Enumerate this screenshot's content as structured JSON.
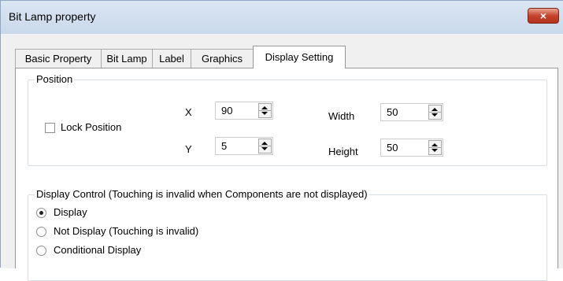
{
  "window": {
    "title": "Bit Lamp property",
    "close_label": "×"
  },
  "tabs": [
    {
      "label": "Basic Property"
    },
    {
      "label": "Bit Lamp"
    },
    {
      "label": "Label"
    },
    {
      "label": "Graphics"
    },
    {
      "label": "Display Setting",
      "active": true
    }
  ],
  "position": {
    "legend": "Position",
    "lock_label": "Lock Position",
    "lock_checked": false,
    "x_label": "X",
    "x_value": "90",
    "y_label": "Y",
    "y_value": "5",
    "width_label": "Width",
    "width_value": "50",
    "height_label": "Height",
    "height_value": "50"
  },
  "display_control": {
    "legend": "Display Control (Touching is invalid when Components are not displayed)",
    "options": [
      {
        "label": "Display",
        "selected": true
      },
      {
        "label": "Not Display (Touching is invalid)",
        "selected": false
      },
      {
        "label": "Conditional Display",
        "selected": false
      }
    ]
  }
}
